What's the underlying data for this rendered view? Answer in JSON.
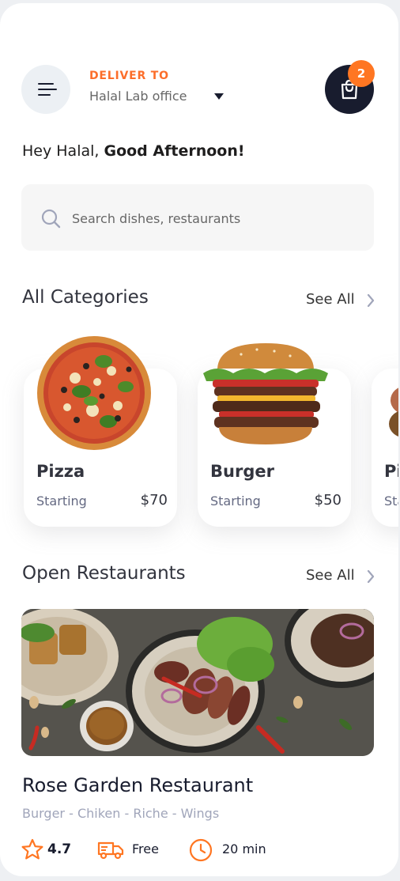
{
  "header": {
    "deliver_label": "DELIVER TO",
    "location": "Halal Lab office",
    "cart_count": "2"
  },
  "greeting": {
    "prefix": "Hey Halal, ",
    "emphasis": "Good Afternoon!"
  },
  "search": {
    "placeholder": "Search dishes, restaurants"
  },
  "categories_section": {
    "title": "All Categories",
    "see_all": "See All",
    "items": [
      {
        "name": "Pizza",
        "starting": "Starting",
        "price": "$70"
      },
      {
        "name": "Burger",
        "starting": "Starting",
        "price": "$50"
      },
      {
        "name": "Pi",
        "starting": "Sta",
        "price": ""
      }
    ]
  },
  "restaurants_section": {
    "title": "Open Restaurants",
    "see_all": "See All",
    "restaurant": {
      "name": "Rose Garden Restaurant",
      "tags": "Burger - Chiken - Riche - Wings",
      "rating": "4.7",
      "delivery": "Free",
      "time": "20 min"
    }
  },
  "colors": {
    "accent": "#ff7622",
    "dark": "#181c2e",
    "muted": "#a0a5ba"
  },
  "icons": [
    "menu-icon",
    "chevron-down-icon",
    "shopping-bag-icon",
    "search-icon",
    "chevron-right-icon",
    "star-icon",
    "delivery-truck-icon",
    "clock-icon"
  ]
}
